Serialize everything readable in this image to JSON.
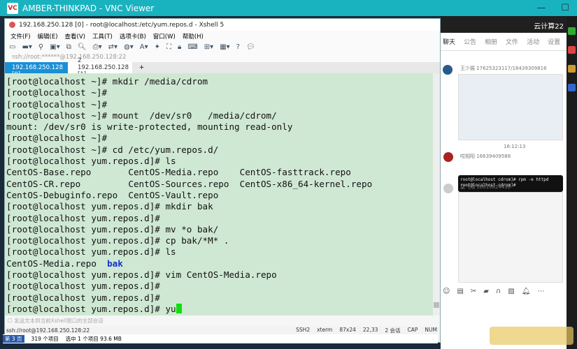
{
  "vnc": {
    "title": "AMBER-THINKPAD - VNC Viewer",
    "logo": "VC",
    "minimize": "—",
    "maximize": "☐"
  },
  "xshell": {
    "title": "192.168.250.128 [0] - root@localhost:/etc/yum.repos.d - Xshell 5",
    "menu": [
      "文件(F)",
      "编辑(E)",
      "查看(V)",
      "工具(T)",
      "选项卡(B)",
      "窗口(W)",
      "帮助(H)"
    ],
    "address": "ssh://root:******@192.168.250.128:22",
    "tabs": [
      {
        "label": "1 192.168.250.128 [0]",
        "active": true
      },
      {
        "label": "2 192.168.250.128 [1]",
        "active": false
      }
    ],
    "add_tab": "+",
    "terminal_lines": [
      "[root@localhost ~]# mkdir /media/cdrom",
      "[root@localhost ~]#",
      "[root@localhost ~]#",
      "[root@localhost ~]# mount  /dev/sr0   /media/cdrom/",
      "mount: /dev/sr0 is write-protected, mounting read-only",
      "[root@localhost ~]#",
      "[root@localhost ~]# cd /etc/yum.repos.d/",
      "[root@localhost yum.repos.d]# ls",
      "CentOS-Base.repo       CentOS-Media.repo    CentOS-fasttrack.repo",
      "CentOS-CR.repo         CentOS-Sources.repo  CentOS-x86_64-kernel.repo",
      "CentOS-Debuginfo.repo  CentOS-Vault.repo",
      "[root@localhost yum.repos.d]# mkdir bak",
      "[root@localhost yum.repos.d]#",
      "[root@localhost yum.repos.d]# mv *o bak/",
      "[root@localhost yum.repos.d]# cp bak/*M* .",
      "[root@localhost yum.repos.d]# ls"
    ],
    "ls_file": "CentOS-Media.repo  ",
    "ls_dir": "bak",
    "terminal_lines2": [
      "[root@localhost yum.repos.d]# vim CentOS-Media.repo",
      "[root@localhost yum.repos.d]#",
      "[root@localhost yum.repos.d]#"
    ],
    "current_line": "[root@localhost yum.repos.d]# yu",
    "send_bar": "发送文本到当前Xshell窗口的全部会话",
    "status_left": "ssh://root@192.168.250.128:22",
    "status_right": [
      "SSH2",
      "xterm",
      "87x24",
      "22,33",
      "2 会话",
      "CAP",
      "NUM"
    ]
  },
  "explorer": {
    "page": "第 3 页",
    "items": "319 个项目",
    "selected": "选中 1 个项目  93.6 MB"
  },
  "chat": {
    "group": "云计算22",
    "tabs": [
      "聊天",
      "公告",
      "相册",
      "文件",
      "活动",
      "设置"
    ],
    "messages": [
      {
        "sender": "王少振 17625323117/18439309816"
      },
      {
        "sender": "哎相阳 16639409588"
      },
      {
        "sender": "莫飞翔 16619824438"
      }
    ],
    "time": "16:12:13",
    "cmd_lines": [
      "root@localhost cdrom]# rpm -e httpd",
      "root@localhost cdrom]# "
    ]
  }
}
